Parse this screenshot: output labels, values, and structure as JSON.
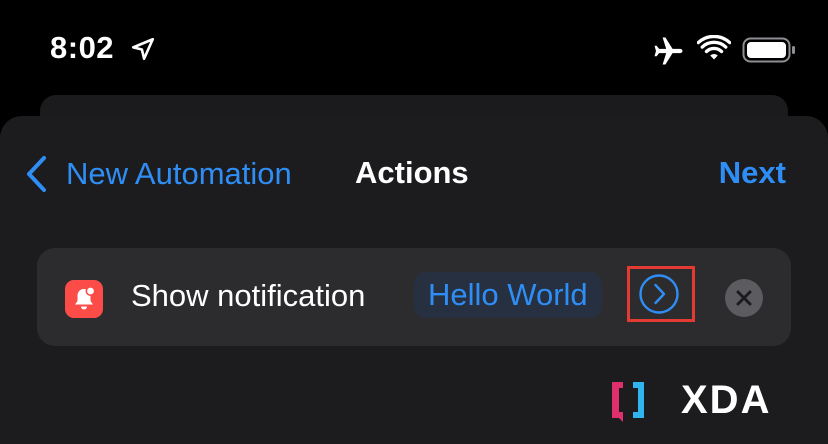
{
  "status_bar": {
    "time": "8:02",
    "icons": [
      "location-arrow-icon",
      "airplane-icon",
      "wifi-icon",
      "battery-icon"
    ]
  },
  "nav": {
    "back_label": "New Automation",
    "title": "Actions",
    "next_label": "Next"
  },
  "action": {
    "app_icon": "notification-bell-icon",
    "label": "Show notification",
    "parameter": "Hello World",
    "expand_icon": "chevron-right-circle-icon",
    "remove_icon": "close-circle-icon"
  },
  "watermark": {
    "logo_text": "XDA"
  },
  "colors": {
    "accent": "#2f8ef6",
    "background": "#000000",
    "sheet": "#1c1c1e",
    "card": "#2c2c2e",
    "app_icon": "#fb4c47",
    "highlight": "#e43a34"
  }
}
